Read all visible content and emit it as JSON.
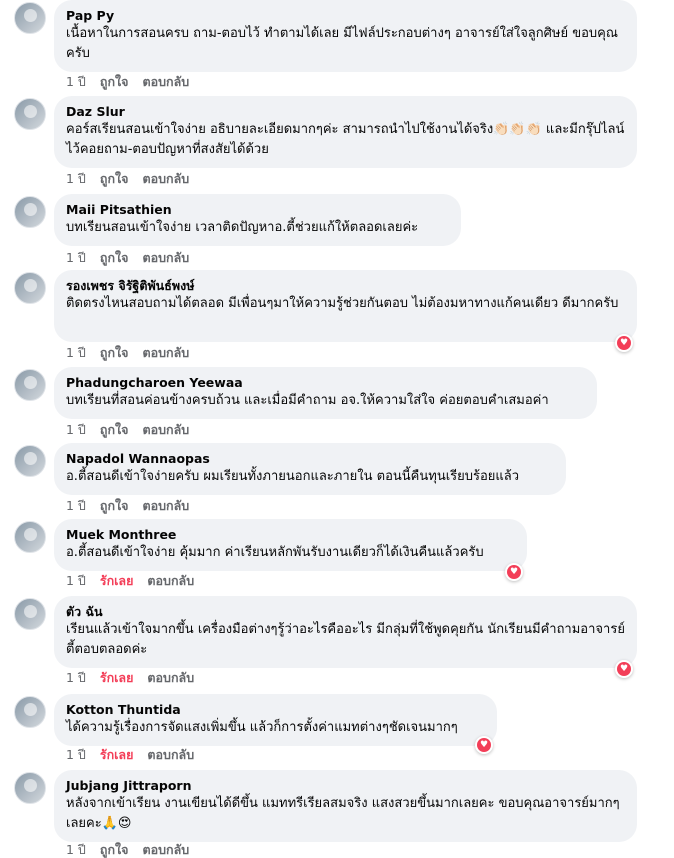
{
  "comments": [
    {
      "name": "Pap Py",
      "text": "เนื้อหาในการสอนครบ ถาม-ตอบไว้ ทำตามได้เลย มีไฟล์ประกอบต่างๆ อาจารย์ใส่ใจลูกศิษย์ ขอบคุณครับ",
      "time": "1 ปี",
      "like": "ถูกใจ",
      "reply": "ตอบกลับ"
    },
    {
      "name": "Daz Slur",
      "text": "คอร์สเรียนสอนเข้าใจง่าย อธิบายละเอียดมากๆค่ะ สามารถนำไปใช้งานได้จริง👏🏻👏🏻👏🏻 และมีกรุ๊ปไลน์ไว้คอยถาม-ตอบปัญหาที่สงสัยได้ด้วย",
      "time": "1 ปี",
      "like": "ถูกใจ",
      "reply": "ตอบกลับ"
    },
    {
      "name": "Maii Pitsathien",
      "text": "บทเรียนสอนเข้าใจง่าย เวลาติดปัญหาอ.ตี้ช่วยแก้ให้ตลอดเลยค่ะ",
      "time": "1 ปี",
      "like": "ถูกใจ",
      "reply": "ตอบกลับ"
    },
    {
      "name": "รองเพชร จิรัฐิติพันธ์พงษ์",
      "text": "ติดตรงไหนสอบถามได้ตลอด มีเพื่อนๆมาให้ความรู้ช่วยกันตอบ ไม่ต้องมหาทางแก้คนเดียว ดีมากครับ",
      "time": "1 ปี",
      "like": "ถูกใจ",
      "reply": "ตอบกลับ"
    },
    {
      "name": "Phadungcharoen Yeewaa",
      "text": "บทเรียนที่สอนค่อนข้างครบถ้วน และเมื่อมีคำถาม อจ.ให้ความใส่ใจ ค่อยตอบคำเสมอค่า",
      "time": "1 ปี",
      "like": "ถูกใจ",
      "reply": "ตอบกลับ"
    },
    {
      "name": "Napadol Wannaopas",
      "text": "อ.ตี้สอนดีเข้าใจง่ายครับ ผมเรียนทั้งภายนอกและภายใน ตอนนี้คืนทุนเรียบร้อยแล้ว",
      "time": "1 ปี",
      "like": "ถูกใจ",
      "reply": "ตอบกลับ"
    },
    {
      "name": "Muek Monthree",
      "text": "อ.ตี้สอนดีเข้าใจง่าย คุ้มมาก ค่าเรียนหลักพันรับงานเดียวก็ได้เงินคืนแล้วครับ",
      "time": "1 ปี",
      "like": "รักเลย",
      "reply": "ตอบกลับ"
    },
    {
      "name": "ตัว ฉัน",
      "text": "เรียนแล้วเข้าใจมากขึ้น เครื่องมือต่างๆรู้ว่าอะไรคืออะไร มีกลุ่มที่ใช้พูดคุยกัน นักเรียนมีคำถามอาจารย์ตี้ตอบตลอดค่ะ",
      "time": "1 ปี",
      "like": "รักเลย",
      "reply": "ตอบกลับ"
    },
    {
      "name": "Kotton Thuntida",
      "text": "ได้ความรู้เรื่องการจัดแสงเพิ่มขึ้น แล้วก็การตั้งค่าแมทต่างๆชัดเจนมากๆ",
      "time": "1 ปี",
      "like": "รักเลย",
      "reply": "ตอบกลับ"
    },
    {
      "name": "Jubjang Jittraporn",
      "text": "หลังจากเข้าเรียน งานเขียนได้ดีขึ้น แมททรีเรียลสมจริง แสงสวยขึ้นมากเลยคะ ขอบคุณอาจารย์มากๆเลยคะ🙏😍",
      "time": "1 ปี",
      "like": "ถูกใจ",
      "reply": "ตอบกลับ"
    }
  ],
  "colors": {
    "bubble": "#f0f2f5",
    "meta": "#65676b",
    "love": "#f33e58"
  },
  "icons": {
    "reaction": "heart-reaction-icon"
  }
}
